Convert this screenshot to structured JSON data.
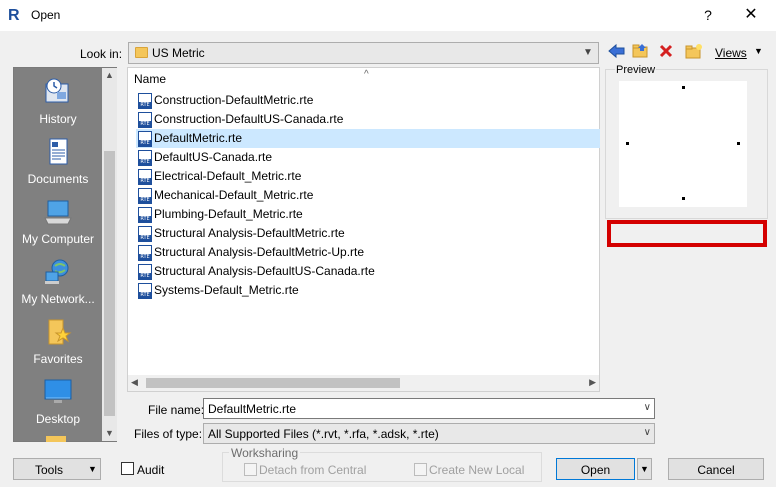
{
  "window": {
    "title": "Open",
    "app_icon": "R",
    "help_label": "?",
    "close_label": "✕"
  },
  "toolbar": {
    "lookin_label": "Look in:",
    "lookin_value": "US Metric",
    "views_label": "Views",
    "icons": [
      "back-arrow-icon",
      "up-folder-icon",
      "delete-icon",
      "new-folder-icon",
      "views-icon"
    ]
  },
  "places": [
    {
      "label": "History",
      "icon": "history-icon"
    },
    {
      "label": "Documents",
      "icon": "documents-icon"
    },
    {
      "label": "My Computer",
      "icon": "computer-icon"
    },
    {
      "label": "My Network...",
      "icon": "network-icon"
    },
    {
      "label": "Favorites",
      "icon": "favorites-icon"
    },
    {
      "label": "Desktop",
      "icon": "desktop-icon"
    }
  ],
  "filelist": {
    "column_header": "Name",
    "selected_index": 2,
    "files": [
      "Construction-DefaultMetric.rte",
      "Construction-DefaultUS-Canada.rte",
      "DefaultMetric.rte",
      "DefaultUS-Canada.rte",
      "Electrical-Default_Metric.rte",
      "Mechanical-Default_Metric.rte",
      "Plumbing-Default_Metric.rte",
      "Structural Analysis-DefaultMetric.rte",
      "Structural Analysis-DefaultMetric-Up.rte",
      "Structural Analysis-DefaultUS-Canada.rte",
      "Systems-Default_Metric.rte"
    ]
  },
  "preview": {
    "label": "Preview"
  },
  "form": {
    "file_name_label": "File name:",
    "file_name_value": "DefaultMetric.rte",
    "file_type_label": "Files of type:",
    "file_type_value": "All Supported Files  (*.rvt, *.rfa, *.adsk, *.rte)"
  },
  "footer": {
    "tools_label": "Tools",
    "audit_label": "Audit",
    "worksharing_label": "Worksharing",
    "detach_label": "Detach from Central",
    "create_local_label": "Create New Local",
    "open_label": "Open",
    "cancel_label": "Cancel"
  },
  "colors": {
    "selection": "#cce8ff",
    "highlight_border": "#d40000",
    "places_bg": "#808080",
    "accent": "#0078d7"
  }
}
